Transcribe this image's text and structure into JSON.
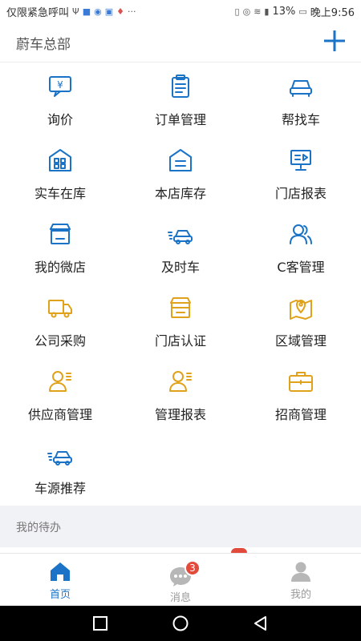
{
  "status_bar": {
    "left_text": "仅限紧急呼叫",
    "battery": "13%",
    "time": "晚上9:56",
    "icons": [
      "usb-icon",
      "app-notification-icon",
      "app-notification-icon",
      "app-notification-icon",
      "location-icon",
      "more-icon",
      "vibrate-icon",
      "eye-icon",
      "wifi-icon",
      "data-icon",
      "battery-icon"
    ]
  },
  "header": {
    "title": "蔚车总部",
    "add_icon": "plus-icon"
  },
  "colors": {
    "blue": "#1a73c7",
    "orange": "#e0a21b",
    "red": "#e24a3b",
    "gray": "#b7b7b7"
  },
  "menu": [
    {
      "label": "询价",
      "icon": "quote-icon",
      "color": "blue"
    },
    {
      "label": "订单管理",
      "icon": "order-clipboard-icon",
      "color": "blue"
    },
    {
      "label": "帮找车",
      "icon": "car-front-icon",
      "color": "blue"
    },
    {
      "label": "实车在库",
      "icon": "warehouse-grid-icon",
      "color": "blue"
    },
    {
      "label": "本店库存",
      "icon": "store-stock-icon",
      "color": "blue"
    },
    {
      "label": "门店报表",
      "icon": "report-board-icon",
      "color": "blue"
    },
    {
      "label": "我的微店",
      "icon": "micro-store-icon",
      "color": "blue"
    },
    {
      "label": "及时车",
      "icon": "fast-car-icon",
      "color": "blue"
    },
    {
      "label": "C客管理",
      "icon": "customers-icon",
      "color": "blue"
    },
    {
      "label": "公司采购",
      "icon": "truck-icon",
      "color": "orange"
    },
    {
      "label": "门店认证",
      "icon": "store-cert-icon",
      "color": "orange"
    },
    {
      "label": "区域管理",
      "icon": "map-pin-icon",
      "color": "orange"
    },
    {
      "label": "供应商管理",
      "icon": "supplier-person-icon",
      "color": "orange"
    },
    {
      "label": "管理报表",
      "icon": "manager-person-icon",
      "color": "orange"
    },
    {
      "label": "招商管理",
      "icon": "briefcase-icon",
      "color": "orange"
    },
    {
      "label": "车源推荐",
      "icon": "car-recommend-icon",
      "color": "blue"
    }
  ],
  "todo": {
    "title": "我的待办"
  },
  "tabs": [
    {
      "label": "首页",
      "icon": "home-icon",
      "active": true
    },
    {
      "label": "消息",
      "icon": "message-icon",
      "badge": "3",
      "active": false
    },
    {
      "label": "我的",
      "icon": "user-icon",
      "active": false
    }
  ],
  "nav_buttons": [
    "recents-square-icon",
    "home-circle-icon",
    "back-triangle-icon"
  ]
}
